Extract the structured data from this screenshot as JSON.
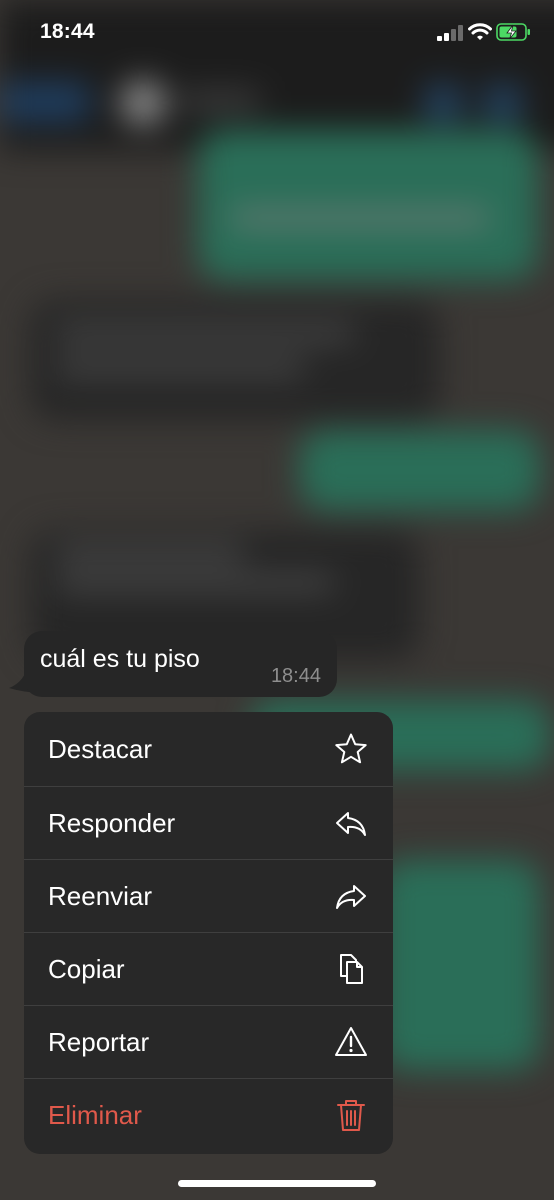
{
  "status_bar": {
    "time": "18:44",
    "icons": [
      "cellular-signal-icon",
      "wifi-icon",
      "battery-charging-icon"
    ]
  },
  "message": {
    "text": "cuál es tu piso",
    "time": "18:44"
  },
  "context_menu": {
    "items": [
      {
        "label": "Destacar",
        "icon": "star-icon",
        "destructive": false
      },
      {
        "label": "Responder",
        "icon": "reply-icon",
        "destructive": false
      },
      {
        "label": "Reenviar",
        "icon": "forward-icon",
        "destructive": false
      },
      {
        "label": "Copiar",
        "icon": "copy-icon",
        "destructive": false
      },
      {
        "label": "Reportar",
        "icon": "warning-icon",
        "destructive": false
      },
      {
        "label": "Eliminar",
        "icon": "trash-icon",
        "destructive": true
      }
    ]
  },
  "colors": {
    "background_dim": "#3b3835",
    "bubble": "#262626",
    "menu": "#282828",
    "destructive": "#e0594b",
    "battery_charging": "#4cd964",
    "timestamp": "#8e8e8e"
  }
}
